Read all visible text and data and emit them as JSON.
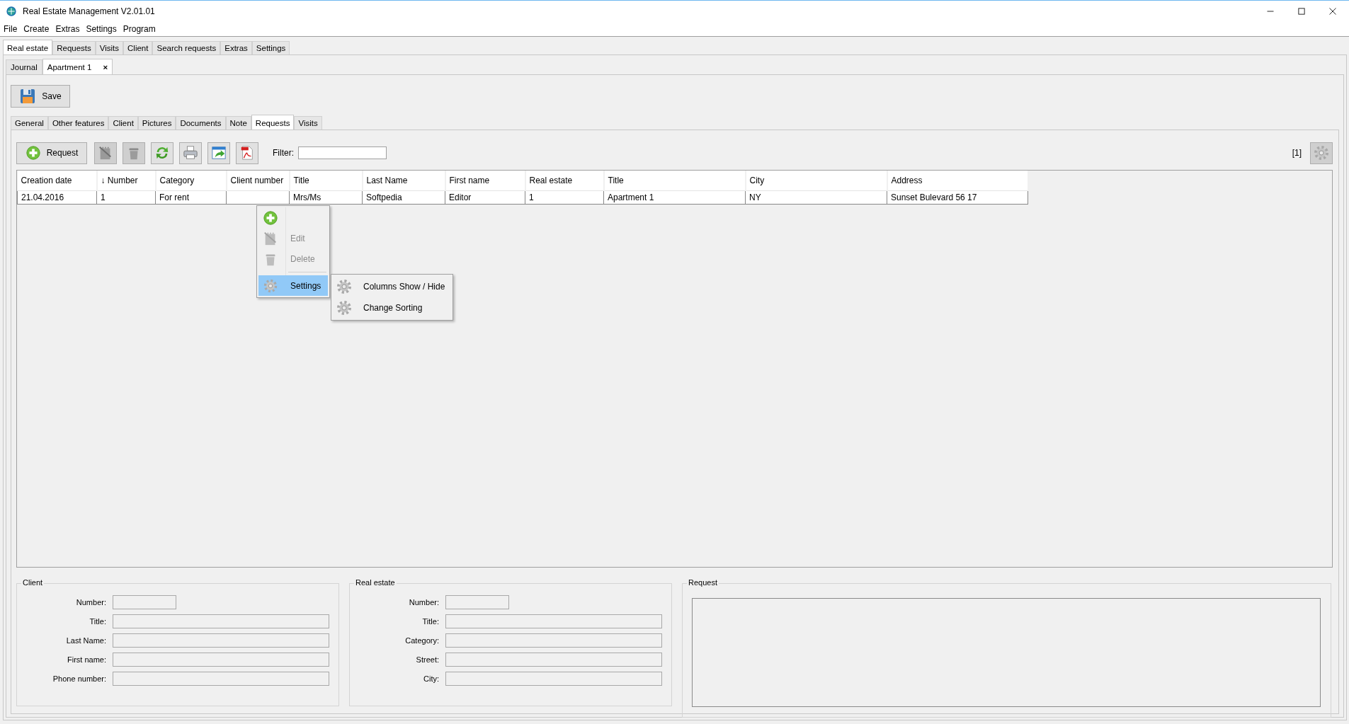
{
  "window": {
    "title": "Real Estate Management V2.01.01"
  },
  "menu": [
    "File",
    "Create",
    "Extras",
    "Settings",
    "Program"
  ],
  "main_tabs": [
    {
      "label": "Real estate",
      "selected": true
    },
    {
      "label": "Requests",
      "selected": false
    },
    {
      "label": "Visits",
      "selected": false
    },
    {
      "label": "Client",
      "selected": false
    },
    {
      "label": "Search requests",
      "selected": false
    },
    {
      "label": "Extras",
      "selected": false
    },
    {
      "label": "Settings",
      "selected": false
    }
  ],
  "document_tabs": [
    {
      "label": "Journal",
      "selected": false
    },
    {
      "label": "Apartment 1",
      "selected": true,
      "close_symbol": "×"
    }
  ],
  "save_button": {
    "label": "Save"
  },
  "sub_tabs": [
    {
      "label": "General",
      "selected": false
    },
    {
      "label": "Other features",
      "selected": false
    },
    {
      "label": "Client",
      "selected": false
    },
    {
      "label": "Pictures",
      "selected": false
    },
    {
      "label": "Documents",
      "selected": false
    },
    {
      "label": "Note",
      "selected": false
    },
    {
      "label": "Requests",
      "selected": true
    },
    {
      "label": "Visits",
      "selected": false
    }
  ],
  "toolbar": {
    "buttons": [
      {
        "kind": "add",
        "label": "Request",
        "disabled": false
      },
      {
        "kind": "edit",
        "disabled": true
      },
      {
        "kind": "delete",
        "disabled": true
      },
      {
        "kind": "refresh",
        "disabled": false
      },
      {
        "kind": "print",
        "disabled": false
      },
      {
        "kind": "export",
        "disabled": false
      },
      {
        "kind": "pdf",
        "disabled": false
      }
    ],
    "filter_label": "Filter:",
    "count": "[1]",
    "settings_button": {
      "disabled": true
    }
  },
  "table": {
    "columns": [
      "Creation date",
      "↓ Number",
      "Category",
      "Client number",
      "Title",
      "Last Name",
      "First name",
      "Real estate",
      "Title",
      "City",
      "Address"
    ],
    "rows": [
      [
        "21.04.2016",
        "1",
        "For rent",
        "",
        "Mrs/Ms",
        "Softpedia",
        "Editor",
        "1",
        "Apartment 1",
        "NY",
        "Sunset Bulevard 56 17"
      ]
    ]
  },
  "context_menu": {
    "items": [
      {
        "kind": "add",
        "disabled": false,
        "selected": false
      },
      {
        "kind": "edit",
        "label": "Edit",
        "disabled": true,
        "selected": false
      },
      {
        "kind": "delete",
        "label": "Delete",
        "disabled": true,
        "selected": false
      },
      {
        "kind": "separator"
      },
      {
        "kind": "settings",
        "label": "Settings",
        "disabled": false,
        "selected": true
      }
    ],
    "submenu": [
      {
        "label": "Columns Show / Hide"
      },
      {
        "label": "Change Sorting"
      }
    ]
  },
  "panels": [
    {
      "kind": "form",
      "title": "Client",
      "fields": [
        {
          "label": "Number:",
          "kind": "short"
        },
        {
          "label": "Title:",
          "kind": "long"
        },
        {
          "label": "Last Name:",
          "kind": "long"
        },
        {
          "label": "First name:",
          "kind": "long"
        },
        {
          "label": "Phone number:",
          "kind": "long"
        }
      ]
    },
    {
      "kind": "form",
      "title": "Real estate",
      "fields": [
        {
          "label": "Number:",
          "kind": "short"
        },
        {
          "label": "Title:",
          "kind": "long"
        },
        {
          "label": "Category:",
          "kind": "long"
        },
        {
          "label": "Street:",
          "kind": "long"
        },
        {
          "label": "City:",
          "kind": "long"
        }
      ]
    },
    {
      "kind": "text",
      "title": "Request"
    }
  ]
}
